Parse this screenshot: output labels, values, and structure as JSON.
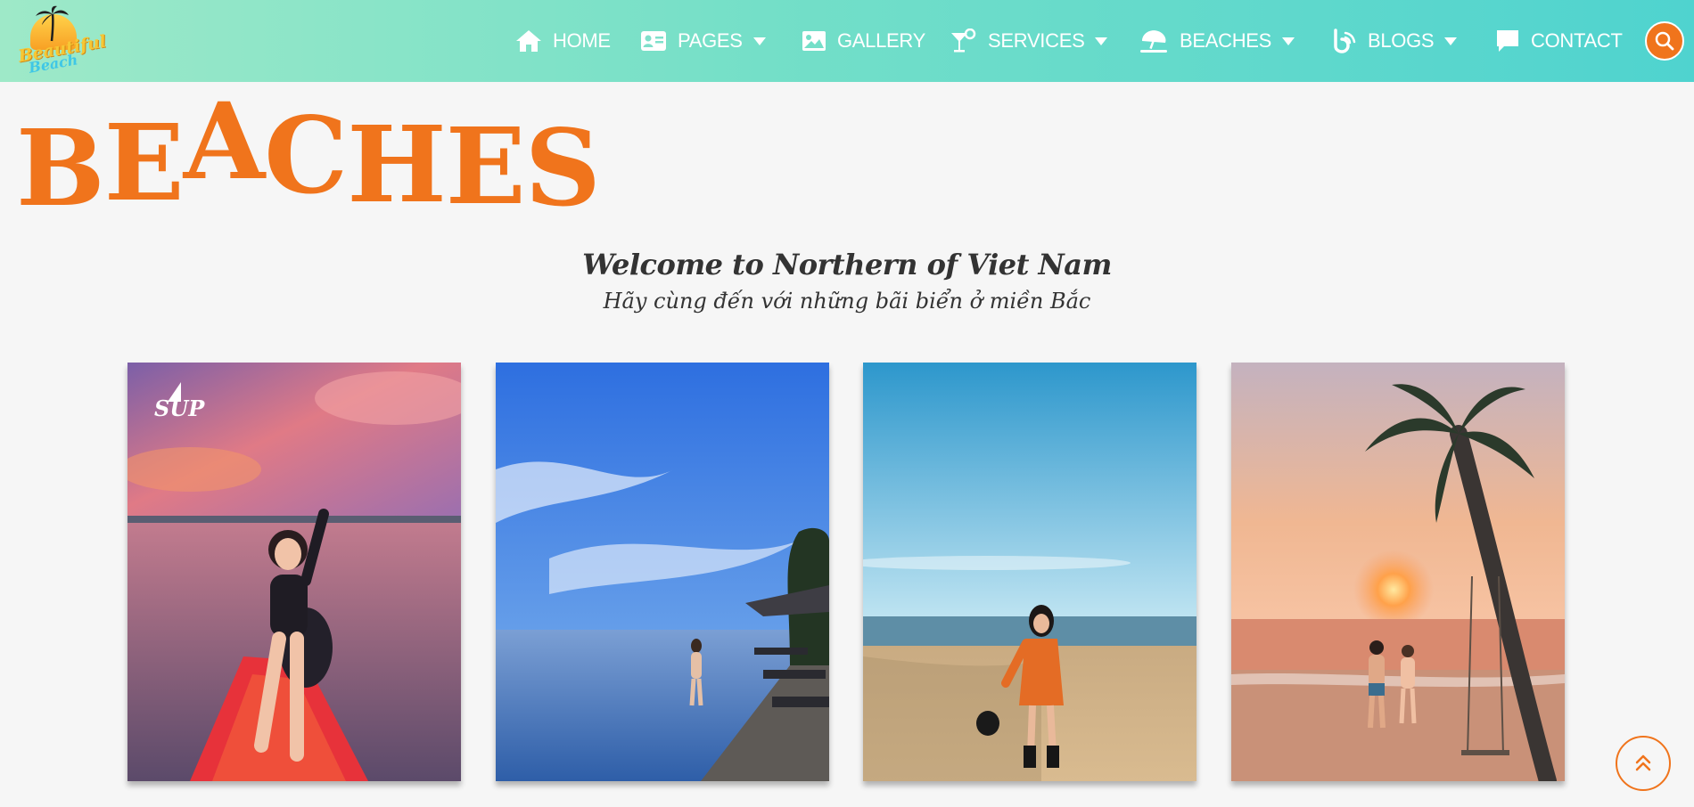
{
  "brand": {
    "logo_line1": "Beautiful",
    "logo_line2": "Beach"
  },
  "nav": {
    "home": "HOME",
    "pages": "PAGES",
    "gallery": "GALLERY",
    "services": "SERVICES",
    "beaches": "BEACHES",
    "blogs": "BLOGS",
    "contact": "CONTACT"
  },
  "page": {
    "title": "BEACHES",
    "welcome": "Welcome to Northern of Viet Nam",
    "subtitle": "Hãy cùng đến với những bãi biển ở miền Bắc"
  },
  "cards": [
    {
      "watermark": "SUP",
      "icon": "photo-sup-sunset"
    },
    {
      "icon": "photo-infinity-pool"
    },
    {
      "icon": "photo-beach-orange-dress"
    },
    {
      "icon": "photo-palm-sunset-couple"
    }
  ],
  "colors": {
    "accent": "#f0741c",
    "nav_start": "#9ee9c8",
    "nav_end": "#4fd3cf",
    "text": "#333333"
  }
}
